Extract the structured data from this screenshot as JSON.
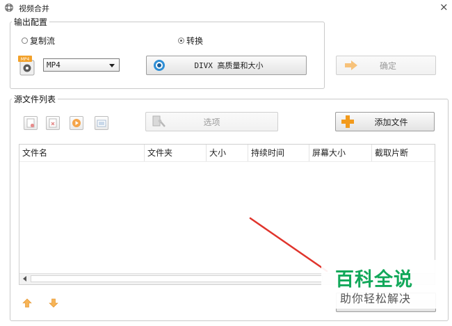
{
  "window": {
    "title": "视频合并",
    "close_glyph": "×"
  },
  "output_config": {
    "legend": "输出配置",
    "radios": [
      {
        "label": "复制流",
        "checked": false
      },
      {
        "label": "转换",
        "checked": true
      }
    ],
    "format_icon_badge": "MP4",
    "format_select": {
      "value": "MP4"
    },
    "quality_button": {
      "label": "DIVX 高质量和大小"
    },
    "confirm_button": {
      "label": "确定",
      "disabled": true
    }
  },
  "source_list": {
    "legend": "源文件列表",
    "toolbar_icons": [
      "add-file-icon",
      "remove-file-icon",
      "play-icon",
      "preview-icon"
    ],
    "options_button": {
      "label": "选项",
      "disabled": true
    },
    "add_file_button": {
      "label": "添加文件"
    },
    "columns": [
      "文件名",
      "文件夹",
      "大小",
      "持续时间",
      "屏幕大小",
      "截取片断"
    ],
    "rows": [],
    "move_icons": [
      "move-up-icon",
      "move-down-icon"
    ]
  },
  "overlay": {
    "watermark_title": "百科全说",
    "watermark_subtitle": "助你轻松解决",
    "arrow_color": "#e0342c"
  },
  "colors": {
    "accent_green": "#12a85a",
    "accent_orange": "#f29a1c"
  }
}
